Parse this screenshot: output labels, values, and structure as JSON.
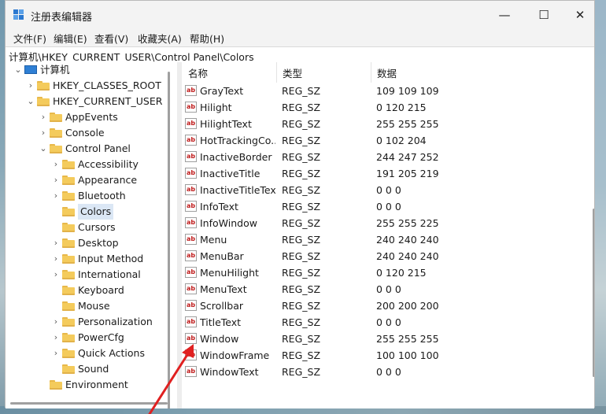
{
  "window": {
    "title": "注册表编辑器",
    "minimize_glyph": "—",
    "maximize_glyph": "☐",
    "close_glyph": "✕"
  },
  "menu": [
    "文件(F)",
    "编辑(E)",
    "查看(V)",
    "收藏夹(A)",
    "帮助(H)"
  ],
  "address": "计算机\\HKEY_CURRENT_USER\\Control Panel\\Colors",
  "tree": [
    {
      "label": "计算机",
      "level": 0,
      "expander": "down",
      "icon": "computer-icon"
    },
    {
      "label": "HKEY_CLASSES_ROOT",
      "level": 1,
      "expander": "right",
      "icon": "folder-icon"
    },
    {
      "label": "HKEY_CURRENT_USER",
      "level": 1,
      "expander": "down",
      "icon": "folder-icon"
    },
    {
      "label": "AppEvents",
      "level": 2,
      "expander": "right",
      "icon": "folder-icon"
    },
    {
      "label": "Console",
      "level": 2,
      "expander": "right",
      "icon": "folder-icon"
    },
    {
      "label": "Control Panel",
      "level": 2,
      "expander": "down",
      "icon": "folder-icon"
    },
    {
      "label": "Accessibility",
      "level": 3,
      "expander": "right",
      "icon": "folder-icon"
    },
    {
      "label": "Appearance",
      "level": 3,
      "expander": "right",
      "icon": "folder-icon"
    },
    {
      "label": "Bluetooth",
      "level": 3,
      "expander": "right",
      "icon": "folder-icon"
    },
    {
      "label": "Colors",
      "level": 3,
      "expander": "none",
      "icon": "folder-icon",
      "selected": true
    },
    {
      "label": "Cursors",
      "level": 3,
      "expander": "none",
      "icon": "folder-icon"
    },
    {
      "label": "Desktop",
      "level": 3,
      "expander": "right",
      "icon": "folder-icon"
    },
    {
      "label": "Input Method",
      "level": 3,
      "expander": "right",
      "icon": "folder-icon"
    },
    {
      "label": "International",
      "level": 3,
      "expander": "right",
      "icon": "folder-icon"
    },
    {
      "label": "Keyboard",
      "level": 3,
      "expander": "none",
      "icon": "folder-icon"
    },
    {
      "label": "Mouse",
      "level": 3,
      "expander": "none",
      "icon": "folder-icon"
    },
    {
      "label": "Personalization",
      "level": 3,
      "expander": "right",
      "icon": "folder-icon"
    },
    {
      "label": "PowerCfg",
      "level": 3,
      "expander": "right",
      "icon": "folder-icon"
    },
    {
      "label": "Quick Actions",
      "level": 3,
      "expander": "right",
      "icon": "folder-icon"
    },
    {
      "label": "Sound",
      "level": 3,
      "expander": "none",
      "icon": "folder-icon"
    },
    {
      "label": "Environment",
      "level": 2,
      "expander": "none",
      "icon": "folder-icon"
    }
  ],
  "list": {
    "headers": {
      "name": "名称",
      "type": "类型",
      "data": "数据"
    },
    "icon_text": "ab",
    "rows": [
      {
        "name": "GrayText",
        "type": "REG_SZ",
        "data": "109 109 109"
      },
      {
        "name": "Hilight",
        "type": "REG_SZ",
        "data": "0 120 215"
      },
      {
        "name": "HilightText",
        "type": "REG_SZ",
        "data": "255 255 255"
      },
      {
        "name": "HotTrackingCo...",
        "type": "REG_SZ",
        "data": "0 102 204"
      },
      {
        "name": "InactiveBorder",
        "type": "REG_SZ",
        "data": "244 247 252"
      },
      {
        "name": "InactiveTitle",
        "type": "REG_SZ",
        "data": "191 205 219"
      },
      {
        "name": "InactiveTitleText",
        "type": "REG_SZ",
        "data": "0 0 0"
      },
      {
        "name": "InfoText",
        "type": "REG_SZ",
        "data": "0 0 0"
      },
      {
        "name": "InfoWindow",
        "type": "REG_SZ",
        "data": "255 255 225"
      },
      {
        "name": "Menu",
        "type": "REG_SZ",
        "data": "240 240 240"
      },
      {
        "name": "MenuBar",
        "type": "REG_SZ",
        "data": "240 240 240"
      },
      {
        "name": "MenuHilight",
        "type": "REG_SZ",
        "data": "0 120 215"
      },
      {
        "name": "MenuText",
        "type": "REG_SZ",
        "data": "0 0 0"
      },
      {
        "name": "Scrollbar",
        "type": "REG_SZ",
        "data": "200 200 200"
      },
      {
        "name": "TitleText",
        "type": "REG_SZ",
        "data": "0 0 0"
      },
      {
        "name": "Window",
        "type": "REG_SZ",
        "data": "255 255 255"
      },
      {
        "name": "WindowFrame",
        "type": "REG_SZ",
        "data": "100 100 100"
      },
      {
        "name": "WindowText",
        "type": "REG_SZ",
        "data": "0 0 0"
      }
    ]
  },
  "annotation": {
    "color": "#e02020",
    "points_to": "Window"
  },
  "colors": {
    "selection": "#dbe7f5",
    "folder": "#f4cb5c",
    "reg_icon_text": "#c01c1c"
  }
}
